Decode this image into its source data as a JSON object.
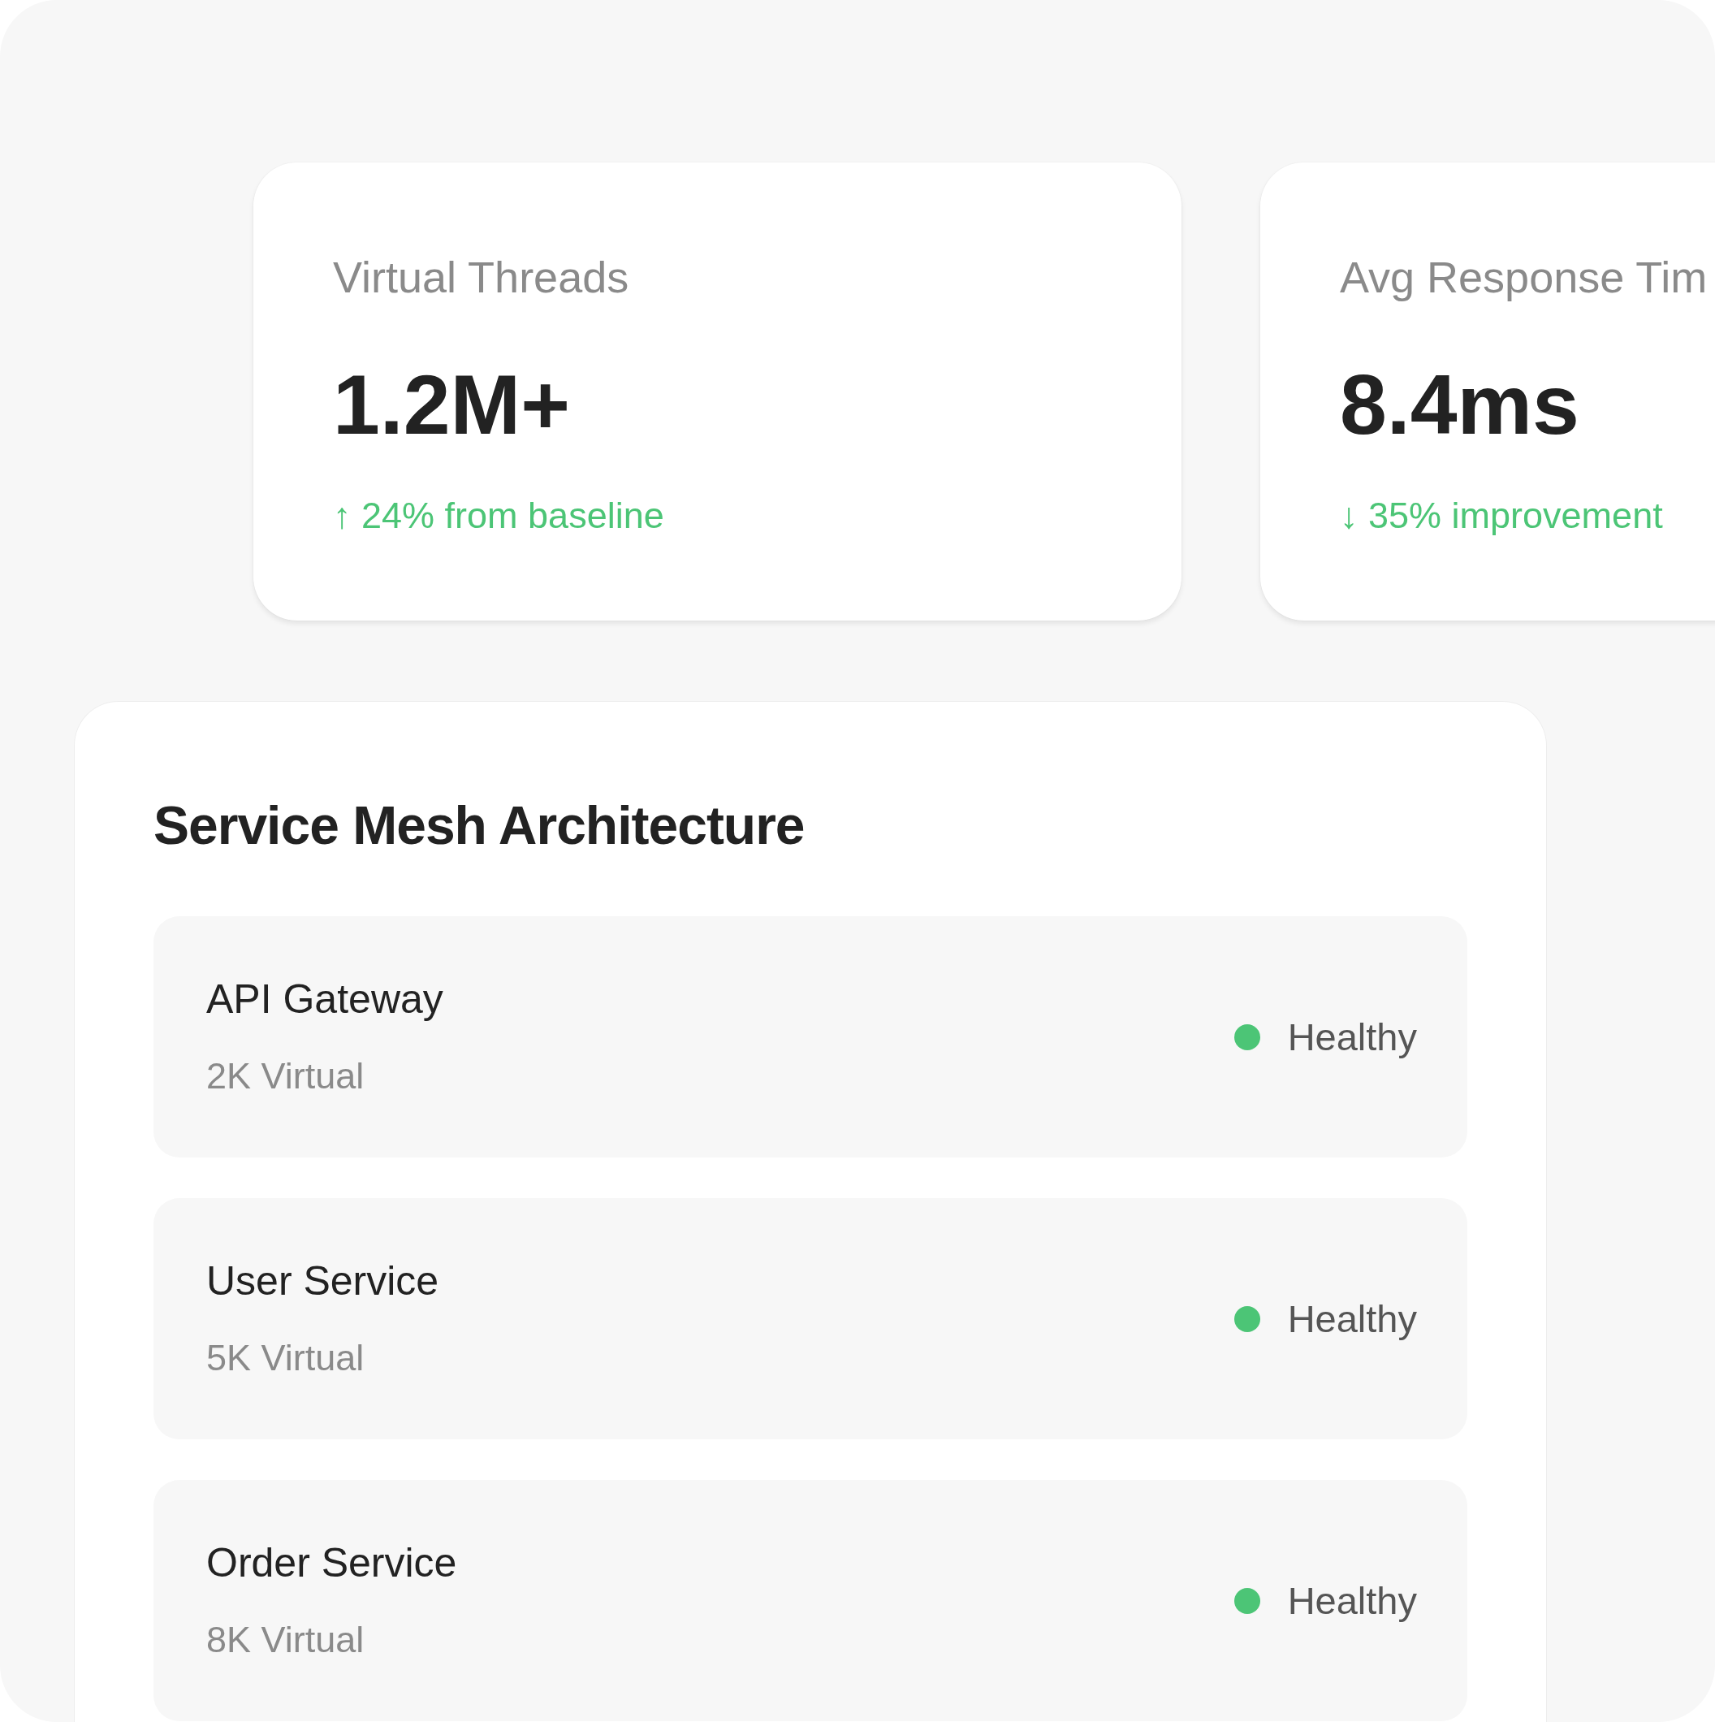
{
  "metrics": [
    {
      "label": "Virtual Threads",
      "value": "1.2M+",
      "change": "↑ 24% from baseline"
    },
    {
      "label": "Avg Response Tim",
      "value": "8.4ms",
      "change": "↓ 35% improvement"
    }
  ],
  "panel": {
    "title": "Service Mesh Architecture",
    "services": [
      {
        "name": "API Gateway",
        "detail": "2K Virtual",
        "status": "Healthy",
        "color": "#4cc576"
      },
      {
        "name": "User Service",
        "detail": "5K Virtual",
        "status": "Healthy",
        "color": "#4cc576"
      },
      {
        "name": "Order Service",
        "detail": "8K Virtual",
        "status": "Healthy",
        "color": "#4cc576"
      }
    ]
  }
}
